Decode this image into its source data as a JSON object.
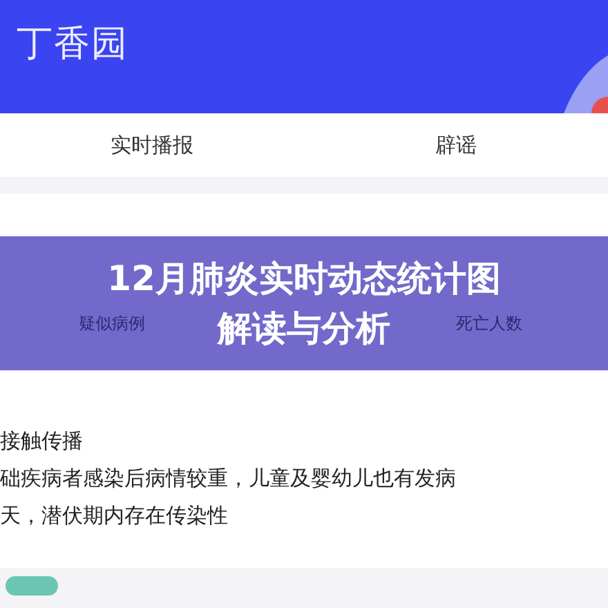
{
  "header": {
    "logo": "丁香园"
  },
  "tabs": [
    {
      "label": "实时播报"
    },
    {
      "label": "辟谣"
    }
  ],
  "stats": [
    {
      "label": "疑似病例"
    },
    {
      "label": "死亡人数"
    }
  ],
  "banner": {
    "lines": [
      "12月肺炎实时动态统计图",
      "解读与分析"
    ]
  },
  "info_lines": [
    "接触传播",
    "础疾病者感染后病情较重，儿童及婴幼儿也有发病",
    "天，潜伏期内存在传染性"
  ]
}
